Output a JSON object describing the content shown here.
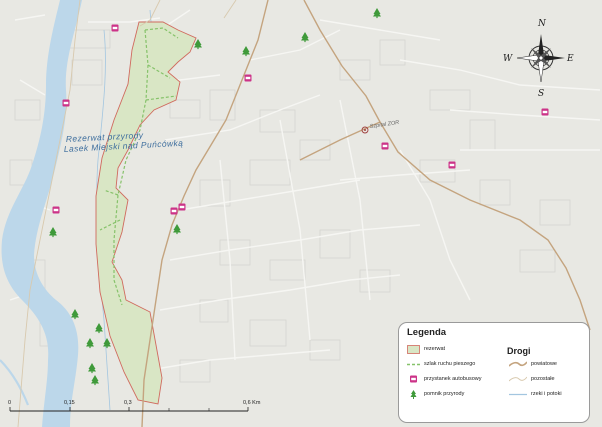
{
  "map": {
    "area_label_line1": "Rezerwat przyrody",
    "area_label_line2": "Lasek Miejski nad Puńcówką",
    "poi_label": "Szpital ZOR",
    "colors": {
      "background": "#e8e8e3",
      "reserve_fill": "#d9e6c5",
      "reserve_outline": "#d06a5e",
      "trail": "#86c26a",
      "road": "#c4a47f",
      "river": "#bcd7ea",
      "river_line": "#a3c6e0",
      "bus_stop": "#cc3388",
      "tree": "#3f9a3a"
    }
  },
  "compass": {
    "north": "N",
    "south": "S",
    "east": "E",
    "west": "W"
  },
  "scale_bar": {
    "ticks": [
      "0",
      "0,15",
      "0,3",
      "",
      "",
      "0,6 Km"
    ]
  },
  "legend": {
    "title": "Legenda",
    "roads_title": "Drogi",
    "items": [
      {
        "label": "rezerwat",
        "symbol": "reserve-fill-icon"
      },
      {
        "label": "szlak ruchu pieszego",
        "symbol": "dashed-trail-icon"
      },
      {
        "label": "przystanek autobusowy",
        "symbol": "bus-stop-icon"
      },
      {
        "label": "pomnik przyrody",
        "symbol": "tree-icon"
      }
    ],
    "road_items": [
      {
        "label": "powiatowe",
        "symbol": "county-road-icon"
      },
      {
        "label": "pozostałe",
        "symbol": "other-road-icon"
      },
      {
        "label": "rzeki i potoki",
        "symbol": "stream-line-icon"
      }
    ]
  }
}
